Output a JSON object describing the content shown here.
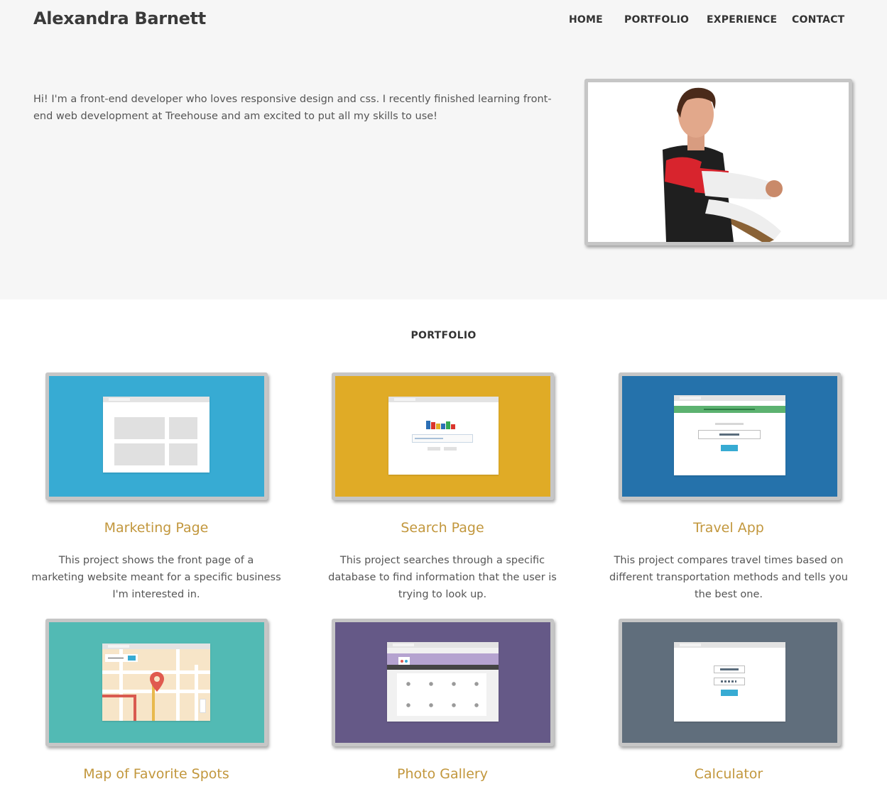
{
  "header": {
    "brand": "Alexandra Barnett",
    "nav": [
      "HOME",
      "PORTFOLIO",
      "EXPERIENCE",
      "CONTACT"
    ]
  },
  "intro": {
    "text": "Hi! I'm a front-end developer who loves responsive design and css. I recently finished learning front-end web development at Treehouse and am excited to put all my skills to use!"
  },
  "portfolio": {
    "heading": "PORTFOLIO",
    "projects": [
      {
        "title": "Marketing Page",
        "description": "This project shows the front page of a marketing website meant for a specific business I'm interested in.",
        "color": "#37abd3"
      },
      {
        "title": "Search Page",
        "description": "This project searches through a specific database to find information that the user is trying to look up.",
        "color": "#e0ab26"
      },
      {
        "title": "Travel App",
        "description": "This project compares travel times based on different transportation methods and tells you the best one.",
        "color": "#2572ab"
      },
      {
        "title": "Map of Favorite Spots",
        "description": "",
        "color": "#52bab4"
      },
      {
        "title": "Photo Gallery",
        "description": "",
        "color": "#655987"
      },
      {
        "title": "Calculator",
        "description": "",
        "color": "#606e7c"
      }
    ]
  },
  "colors": {
    "accent": "#c2973d",
    "hero_bg": "#f6f6f6",
    "frame": "#c6c6c6"
  }
}
